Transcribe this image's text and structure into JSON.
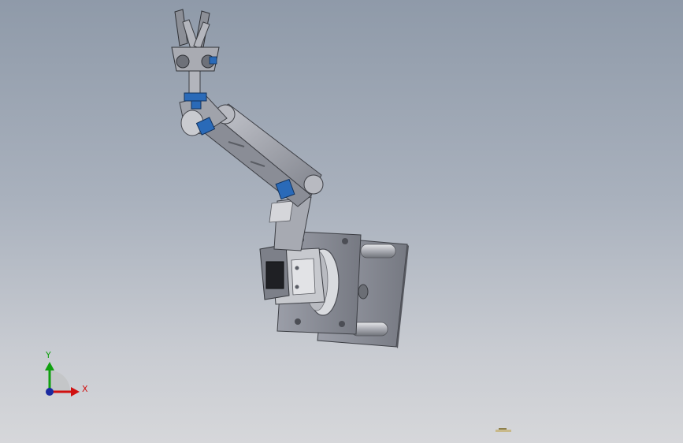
{
  "viewport": {
    "background_top": "#8f9aa9",
    "background_bottom": "#d6d7da"
  },
  "triad": {
    "x_label": "X",
    "y_label": "Y",
    "x_color": "#d01010",
    "y_color": "#10a010",
    "z_color": "#1a2aa0"
  },
  "model": {
    "part_color": "#9a9da6",
    "part_dark": "#5e6169",
    "accent_color": "#2a6ab8",
    "base_plate_color": "#8d8f99"
  }
}
